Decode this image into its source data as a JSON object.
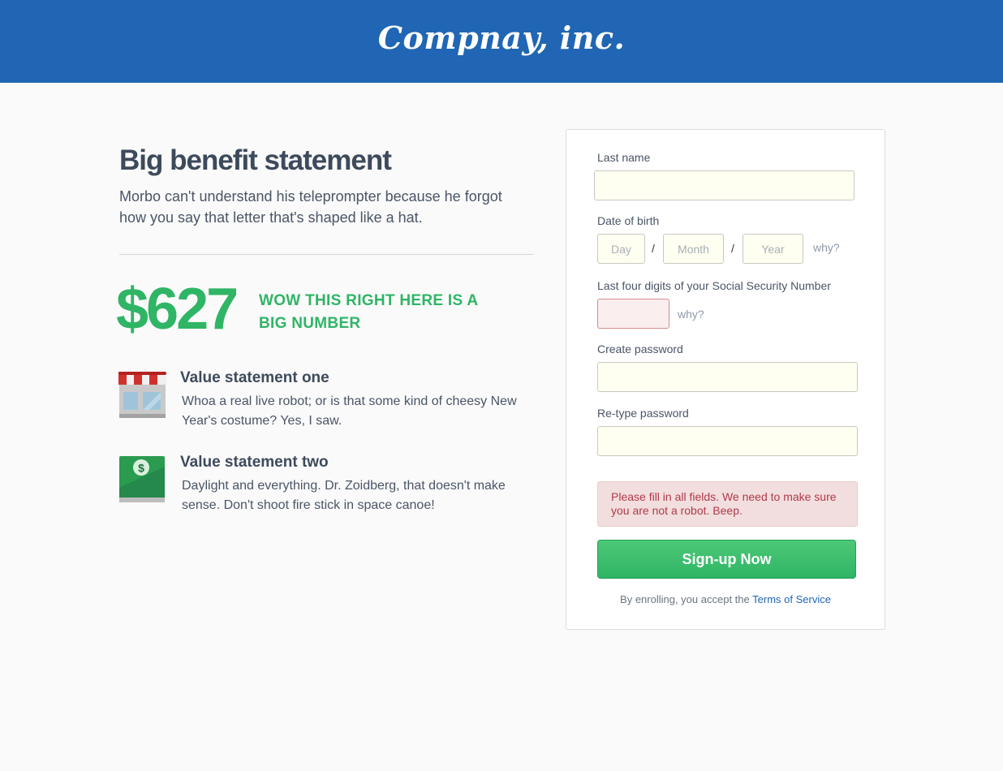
{
  "header": {
    "brand": "Compnay, inc."
  },
  "hero": {
    "headline": "Big benefit statement",
    "subhead": "Morbo can't understand his teleprompter because he forgot how you say that letter that's shaped like a hat.",
    "big_number": "$627",
    "big_number_caption": "WOW THIS RIGHT HERE IS A BIG NUMBER"
  },
  "values": [
    {
      "icon": "storefront-icon",
      "title": "Value statement one",
      "text": "Whoa a real live robot; or is that some kind of cheesy New Year's costume? Yes, I saw."
    },
    {
      "icon": "money-icon",
      "title": "Value statement two",
      "text": "Daylight and everything. Dr. Zoidberg, that doesn't make sense. Don't shoot fire stick in space canoe!"
    }
  ],
  "form": {
    "last_name_label": "Last name",
    "last_name_value": "",
    "dob_label": "Date of birth",
    "dob_day_placeholder": "Day",
    "dob_month_placeholder": "Month",
    "dob_year_placeholder": "Year",
    "dob_separator": "/",
    "why_label": "why?",
    "ssn_label": "Last four digits of your Social Security Number",
    "ssn_value": "",
    "password_label": "Create password",
    "retype_label": "Re-type password",
    "error_message": "Please fill in all fields. We need to make sure you are not a robot. Beep.",
    "submit_label": "Sign-up Now",
    "terms_prefix": "By enrolling, you accept the",
    "terms_link": "Terms of Service"
  },
  "colors": {
    "brand_blue": "#2066b4",
    "accent_green": "#2fb565",
    "error_red": "#b03a4a"
  }
}
